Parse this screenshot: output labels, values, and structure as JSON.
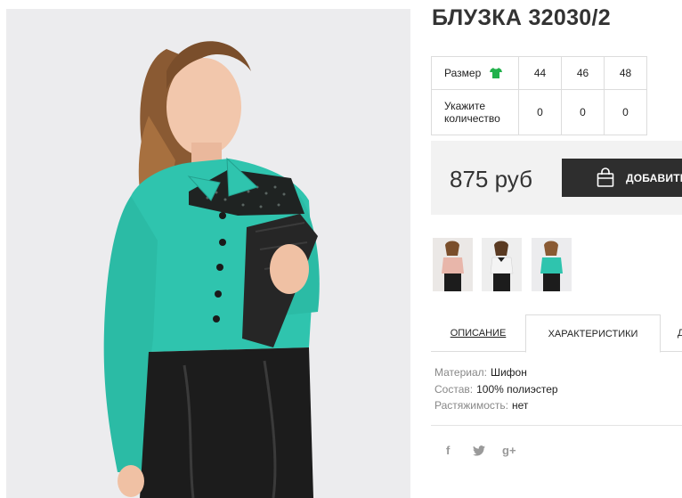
{
  "product": {
    "title": "БЛУЗКА 32030/2",
    "price": "875 руб"
  },
  "size_table": {
    "size_label": "Размер",
    "qty_label": "Укажите количество",
    "sizes": [
      "44",
      "46",
      "48"
    ],
    "quantities": [
      "0",
      "0",
      "0"
    ]
  },
  "cart": {
    "add_label": "ДОБАВИТЬ"
  },
  "tabs": {
    "description": "ОПИСАНИЕ",
    "characteristics": "ХАРАКТЕРИСТИКИ",
    "third_partial": "Д"
  },
  "characteristics": [
    {
      "key": "Материал:",
      "value": "Шифон"
    },
    {
      "key": "Состав:",
      "value": "100% полиэстер"
    },
    {
      "key": "Растяжимость:",
      "value": "нет"
    }
  ],
  "social": {
    "facebook": "f",
    "twitter": "🐦",
    "googleplus": "g+"
  },
  "colors": {
    "blouse": "#2fc4ae",
    "skirt": "#1c1c1c",
    "button_bg": "#2e2e2e",
    "price_bg": "#f2f2f2",
    "size_icon": "#22b14c"
  },
  "icons": {
    "size": "shirt-icon",
    "cart": "shopping-bag-icon",
    "facebook": "facebook-icon",
    "twitter": "twitter-icon",
    "googleplus": "google-plus-icon"
  }
}
